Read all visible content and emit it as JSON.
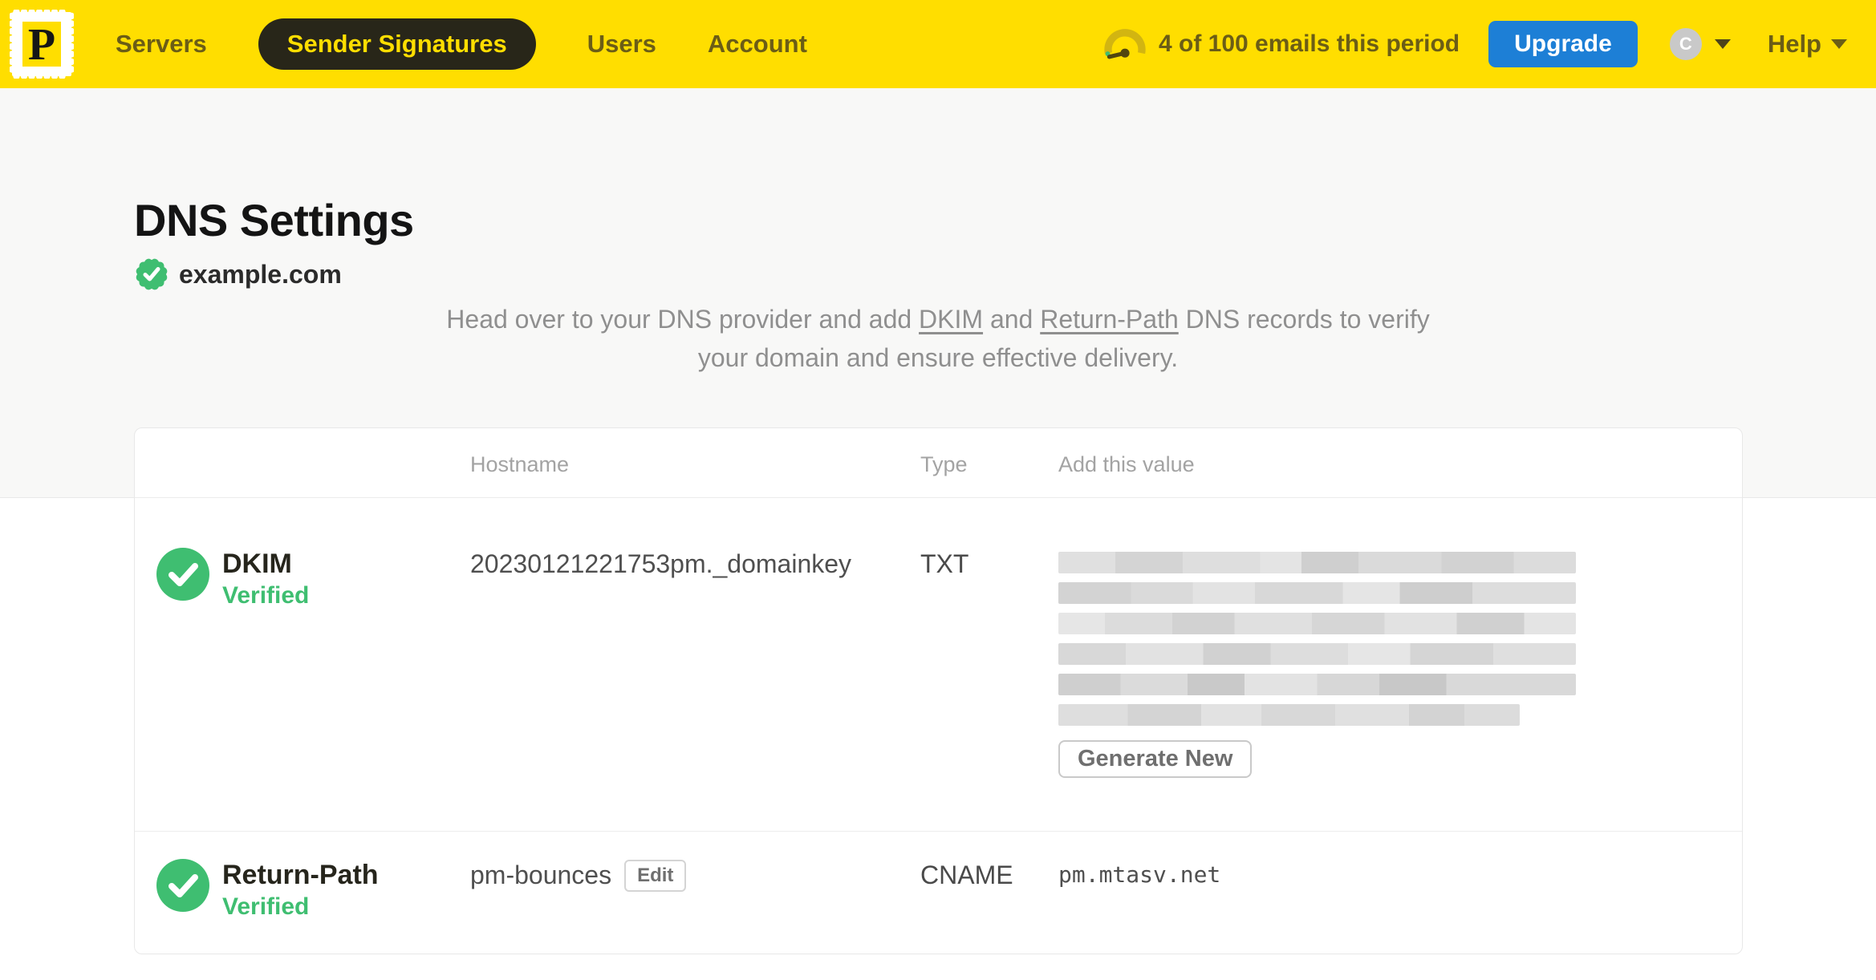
{
  "nav": {
    "logo_letter": "P",
    "items": [
      {
        "label": "Servers",
        "active": false
      },
      {
        "label": "Sender Signatures",
        "active": true
      },
      {
        "label": "Users",
        "active": false
      },
      {
        "label": "Account",
        "active": false
      }
    ],
    "usage_text": "4 of 100 emails this period",
    "upgrade_label": "Upgrade",
    "avatar_initial": "C",
    "help_label": "Help"
  },
  "page": {
    "title": "DNS Settings",
    "domain": "example.com",
    "intro": {
      "before_dkim": "Head over to your DNS provider and add ",
      "dkim_link": "DKIM",
      "between": " and ",
      "return_path_link": "Return-Path",
      "after": " DNS records to verify your domain and ensure effective delivery."
    }
  },
  "table": {
    "headers": {
      "hostname": "Hostname",
      "type": "Type",
      "value": "Add this value"
    },
    "rows": [
      {
        "name": "DKIM",
        "status": "Verified",
        "hostname": "20230121221753pm._domainkey",
        "type": "TXT",
        "value_redacted_rows": 6,
        "action_label": "Generate New"
      },
      {
        "name": "Return-Path",
        "status": "Verified",
        "hostname": "pm-bounces",
        "edit_label": "Edit",
        "type": "CNAME",
        "value": "pm.mtasv.net"
      }
    ]
  },
  "colors": {
    "brand_yellow": "#FFDE00",
    "accent_blue": "#1D7FD6",
    "success_green": "#3FBE71",
    "nav_text": "#6B5D16"
  }
}
